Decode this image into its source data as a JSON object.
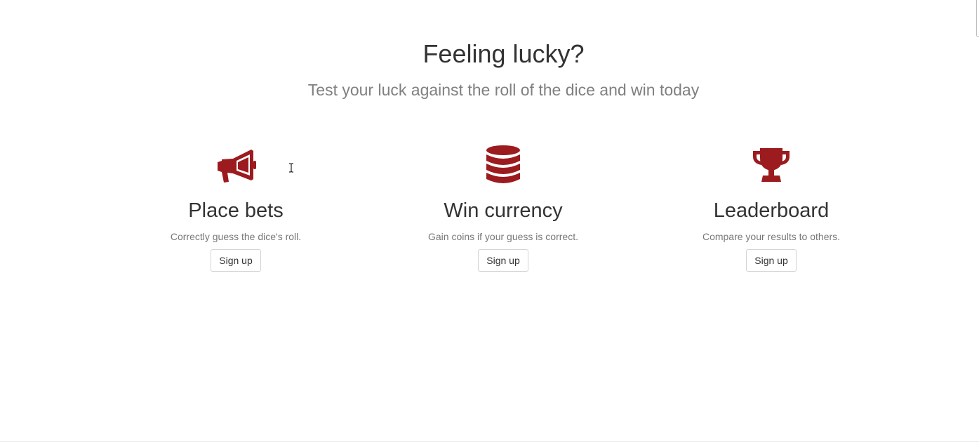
{
  "hero": {
    "title": "Feeling lucky?",
    "subtitle": "Test your luck against the roll of the dice and win today"
  },
  "features": [
    {
      "icon": "megaphone-icon",
      "title": "Place bets",
      "description": "Correctly guess the dice's roll.",
      "button_label": "Sign up"
    },
    {
      "icon": "coin-stack-icon",
      "title": "Win currency",
      "description": "Gain coins if your guess is correct.",
      "button_label": "Sign up"
    },
    {
      "icon": "trophy-icon",
      "title": "Leaderboard",
      "description": "Compare your results to others.",
      "button_label": "Sign up"
    }
  ],
  "colors": {
    "icon_accent": "#9b1b1f",
    "button_border": "#d4d4d4",
    "subtitle_text": "#808080"
  }
}
